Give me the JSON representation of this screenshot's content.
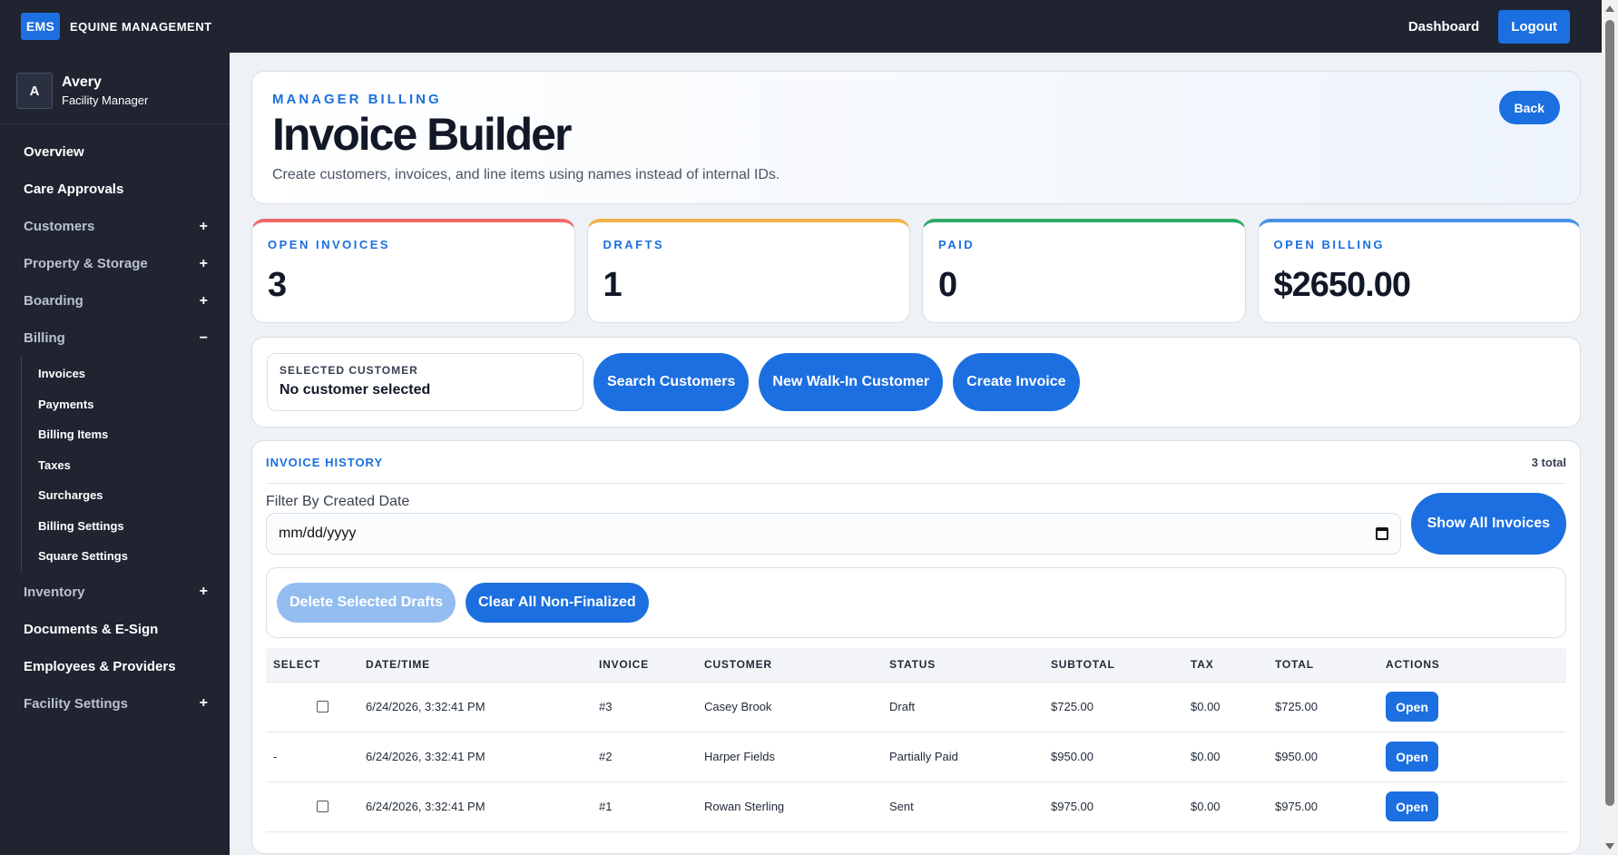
{
  "app": {
    "logo": "EMS",
    "name": "EQUINE MANAGEMENT"
  },
  "topnav": {
    "dashboard": "Dashboard",
    "logout": "Logout"
  },
  "user": {
    "initial": "A",
    "name": "Avery",
    "role": "Facility Manager"
  },
  "sidebar": {
    "overview": "Overview",
    "care_approvals": "Care Approvals",
    "customers": "Customers",
    "property_storage": "Property & Storage",
    "boarding": "Boarding",
    "billing": "Billing",
    "billing_sub": [
      "Invoices",
      "Payments",
      "Billing Items",
      "Taxes",
      "Surcharges",
      "Billing Settings",
      "Square Settings"
    ],
    "inventory": "Inventory",
    "documents": "Documents & E-Sign",
    "employees": "Employees & Providers",
    "facility_settings": "Facility Settings",
    "expand_symbol": "+",
    "collapse_symbol": "−"
  },
  "header": {
    "eyebrow": "MANAGER BILLING",
    "title": "Invoice Builder",
    "subtitle": "Create customers, invoices, and line items using names instead of internal IDs.",
    "back": "Back"
  },
  "stats": [
    {
      "label": "OPEN INVOICES",
      "value": "3",
      "color": "#f06a6a"
    },
    {
      "label": "DRAFTS",
      "value": "1",
      "color": "#f2b34a"
    },
    {
      "label": "PAID",
      "value": "0",
      "color": "#2eab64"
    },
    {
      "label": "OPEN BILLING",
      "value": "$2650.00",
      "color": "#4a90e8"
    }
  ],
  "actions": {
    "selected_label": "SELECTED CUSTOMER",
    "selected_value": "No customer selected",
    "search": "Search Customers",
    "walk_in": "New Walk-In Customer",
    "create": "Create Invoice"
  },
  "history": {
    "title": "INVOICE HISTORY",
    "count": "3 total",
    "filter_label": "Filter By Created Date",
    "date_placeholder": "mm/dd/yyyy",
    "show_all": "Show All Invoices",
    "delete_drafts": "Delete Selected Drafts",
    "clear_non_finalized": "Clear All Non-Finalized",
    "columns": [
      "SELECT",
      "DATE/TIME",
      "INVOICE",
      "CUSTOMER",
      "STATUS",
      "SUBTOTAL",
      "TAX",
      "TOTAL",
      "ACTIONS"
    ],
    "rows": [
      {
        "select": "checkbox",
        "datetime": "6/24/2026, 3:32:41 PM",
        "invoice": "#3",
        "customer": "Casey Brook",
        "status": "Draft",
        "subtotal": "$725.00",
        "tax": "$0.00",
        "total": "$725.00",
        "action": "Open"
      },
      {
        "select": "-",
        "datetime": "6/24/2026, 3:32:41 PM",
        "invoice": "#2",
        "customer": "Harper Fields",
        "status": "Partially Paid",
        "subtotal": "$950.00",
        "tax": "$0.00",
        "total": "$950.00",
        "action": "Open"
      },
      {
        "select": "checkbox",
        "datetime": "6/24/2026, 3:32:41 PM",
        "invoice": "#1",
        "customer": "Rowan Sterling",
        "status": "Sent",
        "subtotal": "$975.00",
        "tax": "$0.00",
        "total": "$975.00",
        "action": "Open"
      }
    ]
  }
}
